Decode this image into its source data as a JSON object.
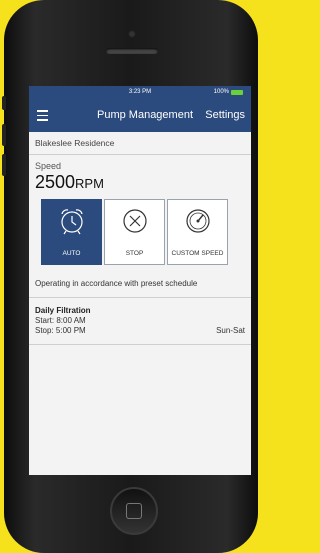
{
  "status_bar": {
    "time": "3:23 PM",
    "battery": "100%"
  },
  "nav": {
    "title": "Pump Management",
    "settings_label": "Settings"
  },
  "location": "Blakeslee Residence",
  "speed": {
    "label": "Speed",
    "value": "2500",
    "unit": "RPM"
  },
  "modes": [
    {
      "label": "AUTO",
      "icon": "alarm-clock-icon",
      "active": true
    },
    {
      "label": "STOP",
      "icon": "stop-x-icon",
      "active": false
    },
    {
      "label": "CUSTOM SPEED",
      "icon": "gauge-icon",
      "active": false
    }
  ],
  "status_message": "Operating in accordance with preset schedule",
  "schedule": {
    "name": "Daily Filtration",
    "start": "Start: 8:00 AM",
    "stop": "Stop: 5:00 PM",
    "days": "Sun-Sat"
  },
  "colors": {
    "header": "#2b4a7d",
    "background": "#f6e21c",
    "battery": "#6bd13a"
  }
}
